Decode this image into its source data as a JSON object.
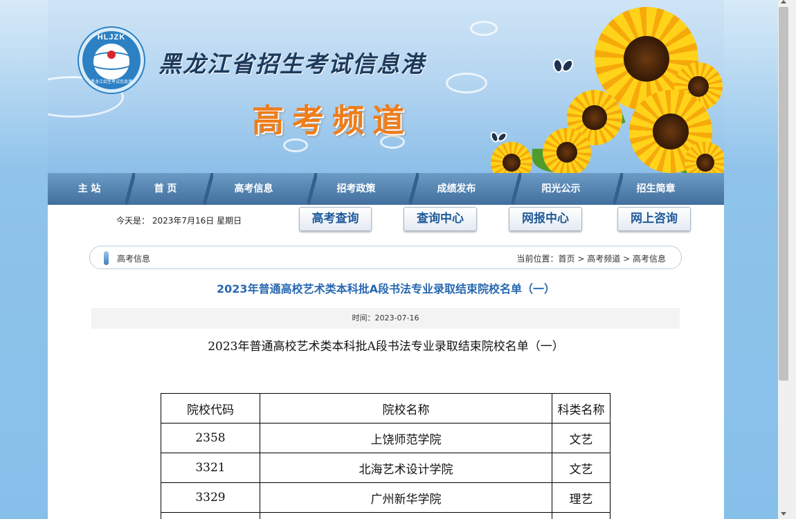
{
  "header": {
    "logo_top_text": "HLJZK",
    "logo_ring_text": "黑龙江招生考试信息港",
    "site_name": "黑龙江省招生考试信息港",
    "channel_title": "高考频道"
  },
  "nav": {
    "items": [
      {
        "label": "主 站"
      },
      {
        "label": "首 页"
      },
      {
        "label": "高考信息"
      },
      {
        "label": "招考政策"
      },
      {
        "label": "成绩发布"
      },
      {
        "label": "阳光公示"
      },
      {
        "label": "招生简章"
      }
    ]
  },
  "toolbar": {
    "date_text": "今天是： 2023年7月16日 星期日",
    "buttons": [
      {
        "label": "高考查询"
      },
      {
        "label": "查询中心"
      },
      {
        "label": "网报中心"
      },
      {
        "label": "网上咨询"
      }
    ]
  },
  "breadcrumb": {
    "section": "高考信息",
    "prefix": "当前位置：",
    "items": [
      {
        "label": "首页"
      },
      {
        "label": "高考频道"
      },
      {
        "label": "高考信息"
      }
    ],
    "separator": ">"
  },
  "article": {
    "title": "2023年普通高校艺术类本科批A段书法专业录取结束院校名单（一）",
    "time_text": "时间：2023-07-16",
    "subtitle": "2023年普通高校艺术类本科批A段书法专业录取结束院校名单（一）"
  },
  "table": {
    "headers": [
      "院校代码",
      "院校名称",
      "科类名称"
    ],
    "rows": [
      [
        "2358",
        "上饶师范学院",
        "文艺"
      ],
      [
        "3321",
        "北海艺术设计学院",
        "文艺"
      ],
      [
        "3329",
        "广州新华学院",
        "理艺"
      ],
      [
        "",
        "",
        ""
      ]
    ]
  },
  "colors": {
    "nav_bg": "#4d7ba8",
    "title_blue": "#2868b0",
    "channel_orange": "#ef7d1a"
  }
}
